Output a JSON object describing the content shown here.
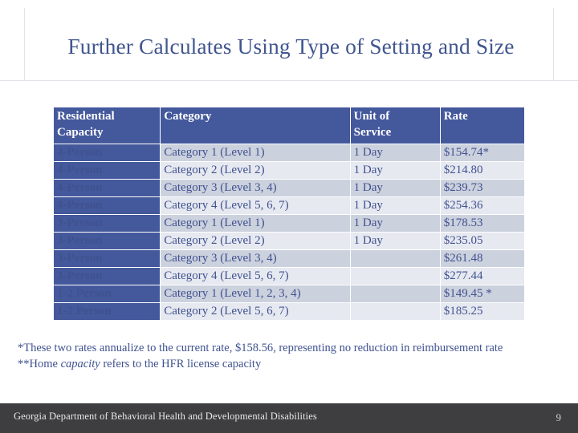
{
  "slide": {
    "title": "Further Calculates Using Type of Setting and Size",
    "accent_blue": "#44589c",
    "title_color": "#41568f",
    "row_odd_color": "#ccd1de",
    "row_even_color": "#e7e9f1",
    "footer_bar_color": "#3e3e40"
  },
  "table": {
    "columns": [
      "Residential Capacity",
      "Category",
      "Unit of Service",
      "Rate"
    ],
    "column_headers": {
      "capacity_line1": "Residential",
      "capacity_line2": "Capacity",
      "category": "Category",
      "unit_line1": "Unit of",
      "unit_line2": "Service",
      "rate": "Rate"
    },
    "rows": [
      {
        "capacity": "4-Person",
        "category": "Category 1 (Level 1)",
        "unit": "1 Day",
        "rate": "$154.74*"
      },
      {
        "capacity": "4-Person",
        "category": "Category 2 (Level 2)",
        "unit": "1 Day",
        "rate": "$214.80"
      },
      {
        "capacity": "4-Person",
        "category": "Category 3 (Level 3, 4)",
        "unit": "1 Day",
        "rate": "$239.73"
      },
      {
        "capacity": "4-Person",
        "category": "Category 4 (Level 5, 6, 7)",
        "unit": "1 Day",
        "rate": "$254.36"
      },
      {
        "capacity": "3-Person",
        "category": "Category 1 (Level 1)",
        "unit": "1 Day",
        "rate": "$178.53"
      },
      {
        "capacity": "3-Person",
        "category": "Category 2 (Level 2)",
        "unit": "1 Day",
        "rate": "$235.05"
      },
      {
        "capacity": "3-Person",
        "category": "Category 3 (Level 3, 4)",
        "unit": "",
        "rate": "$261.48"
      },
      {
        "capacity": "3-Person",
        "category": "Category 4 (Level 5, 6, 7)",
        "unit": "",
        "rate": "$277.44"
      },
      {
        "capacity": "1-2 Person",
        "category": "Category 1 (Level 1, 2, 3, 4)",
        "unit": "",
        "rate": "$149.45 *"
      },
      {
        "capacity": "1-2 Person",
        "category": "Category 2 (Level 5, 6, 7)",
        "unit": "",
        "rate": "$185.25"
      }
    ]
  },
  "footnotes": {
    "note1": "*These two rates annualize to the current rate, $158.56, representing no reduction in reimbursement rate",
    "note2_prefix": "**Home ",
    "note2_italic": "capacity",
    "note2_suffix": " refers to the HFR license capacity"
  },
  "footer": {
    "organization": "Georgia Department of Behavioral Health and Developmental Disabilities",
    "page_number": "9"
  }
}
